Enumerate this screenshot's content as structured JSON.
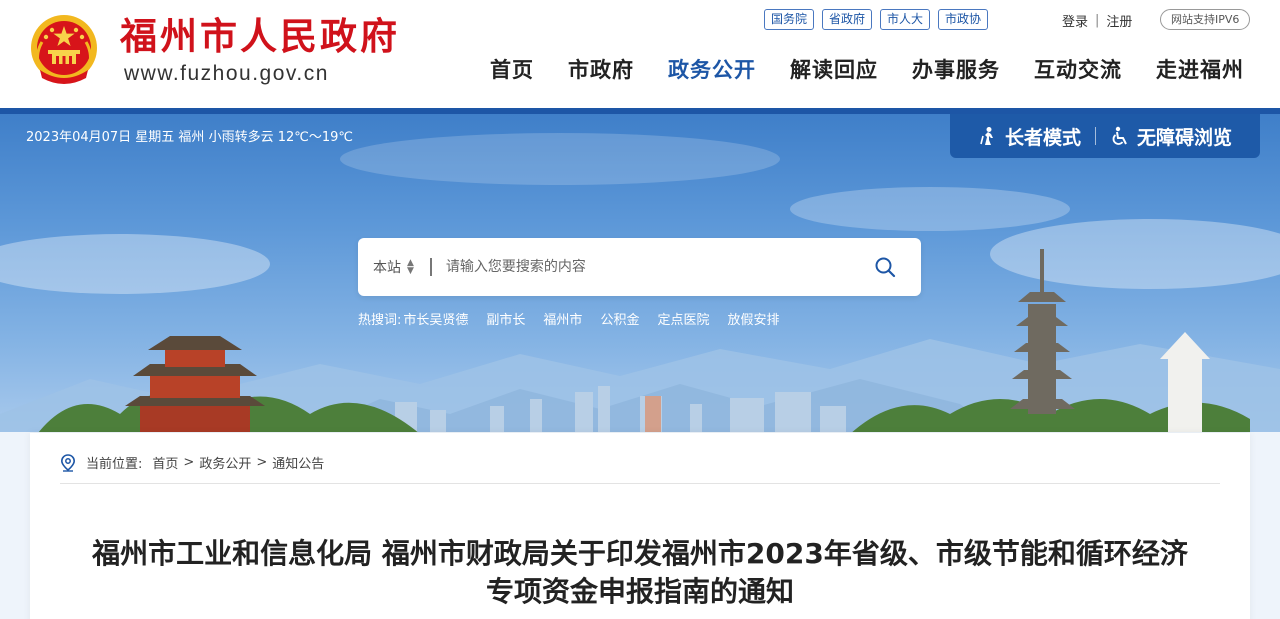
{
  "header": {
    "site_name": "福州市人民政府",
    "site_url": "www.fuzhou.gov.cn",
    "top_links": [
      "国务院",
      "省政府",
      "市人大",
      "市政协"
    ],
    "login": "登录",
    "auth_sep": "|",
    "register": "注册",
    "ipv6_badge": "网站支持IPV6"
  },
  "nav": [
    "首页",
    "市政府",
    "政务公开",
    "解读回应",
    "办事服务",
    "互动交流",
    "走进福州"
  ],
  "nav_active_index": 2,
  "banner": {
    "weather": "2023年04月07日 星期五  福州 小雨转多云 12℃～19℃",
    "elder_mode": "长者模式",
    "accessible": "无障碍浏览"
  },
  "search": {
    "scope": "本站",
    "placeholder": "请输入您要搜索的内容",
    "hot_label": "热搜词:",
    "hot_words": [
      "市长吴贤德",
      "副市长",
      "福州市",
      "公积金",
      "定点医院",
      "放假安排"
    ]
  },
  "breadcrumb": {
    "label": "当前位置:",
    "sep": ">",
    "items": [
      "首页",
      "政务公开",
      "通知公告"
    ]
  },
  "article": {
    "title": "福州市工业和信息化局 福州市财政局关于印发福州市2023年省级、市级节能和循环经济专项资金申报指南的通知"
  },
  "colors": {
    "brand_red": "#d0121b",
    "brand_blue": "#1d56a6",
    "access_bar": "#1e5aa8"
  },
  "icons": [
    "national-emblem-icon",
    "elder-icon",
    "wheelchair-icon",
    "search-icon",
    "location-icon",
    "scope-arrow-icon"
  ]
}
